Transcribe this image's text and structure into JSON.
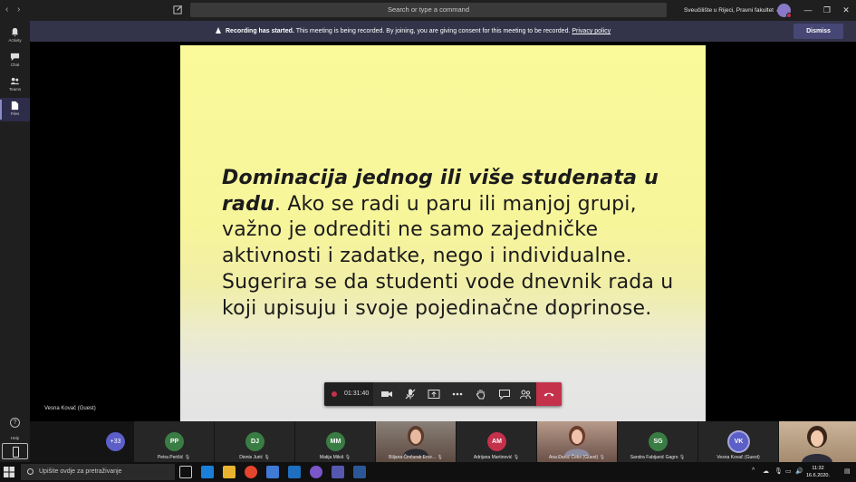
{
  "window": {
    "search_placeholder": "Search or type a command",
    "org_name": "Sveučilište u Rijeci, Pravni fakultet",
    "user_initials": "",
    "window_controls": [
      "minimize",
      "restore",
      "close"
    ]
  },
  "rail": {
    "items": [
      {
        "label": "Activity",
        "icon": "bell-icon"
      },
      {
        "label": "Chat",
        "icon": "chat-icon"
      },
      {
        "label": "Teams",
        "icon": "teams-icon"
      },
      {
        "label": "Files",
        "icon": "files-icon",
        "active": true
      }
    ],
    "help_label": "Help"
  },
  "banner": {
    "title": "Recording has started.",
    "text": "This meeting is being recorded. By joining, you are giving consent for this meeting to be recorded.",
    "link": "Privacy policy",
    "dismiss_label": "Dismiss"
  },
  "slide": {
    "emphasis": "Dominacija jednog ili više studenata u radu",
    "punct": ".",
    "body": "Ako se radi u paru ili manjoj grupi, važno je odrediti ne samo zajedničke aktivnosti i zadatke, nego i individualne. Sugerira se da studenti vode dnevnik rada u koji upisuju i svoje pojedinačne doprinose."
  },
  "speaker_name": "Vesna Kovač (Guest)",
  "controls": {
    "timer": "01:31:40",
    "buttons": [
      "camera-icon",
      "microphone-icon",
      "share-screen-icon",
      "more-actions-icon",
      "raise-hand-icon",
      "chat-icon",
      "participants-icon",
      "hang-up-icon"
    ]
  },
  "participants": {
    "more_count": "+33",
    "tiles": [
      {
        "initials": "PP",
        "name": "Petra Perišić",
        "color": "#3a7d44",
        "photo": false
      },
      {
        "initials": "DJ",
        "name": "Dionis Jurić",
        "color": "#3a7d44",
        "photo": false
      },
      {
        "initials": "MM",
        "name": "Matija Miloš",
        "color": "#3a7d44",
        "photo": false
      },
      {
        "initials": "",
        "name": "Biljana Činčurak Erce...",
        "color": "#7a6a5a",
        "photo": true
      },
      {
        "initials": "AM",
        "name": "Adrijana Martinović",
        "color": "#c4314b",
        "photo": false
      },
      {
        "initials": "",
        "name": "Ana Đanić Čeko (Guest)",
        "color": "#8a6a5a",
        "photo": true
      },
      {
        "initials": "SG",
        "name": "Sandra Fabijanić Gagro",
        "color": "#3a7d44",
        "photo": false
      },
      {
        "initials": "VK",
        "name": "Vesna Kovač (Guest)",
        "color": "#5b5fc7",
        "photo": false,
        "speaking": true
      }
    ]
  },
  "taskbar": {
    "search_placeholder": "Upišite ovdje za pretraživanje",
    "time": "11:32",
    "date": "16.6.2020."
  }
}
